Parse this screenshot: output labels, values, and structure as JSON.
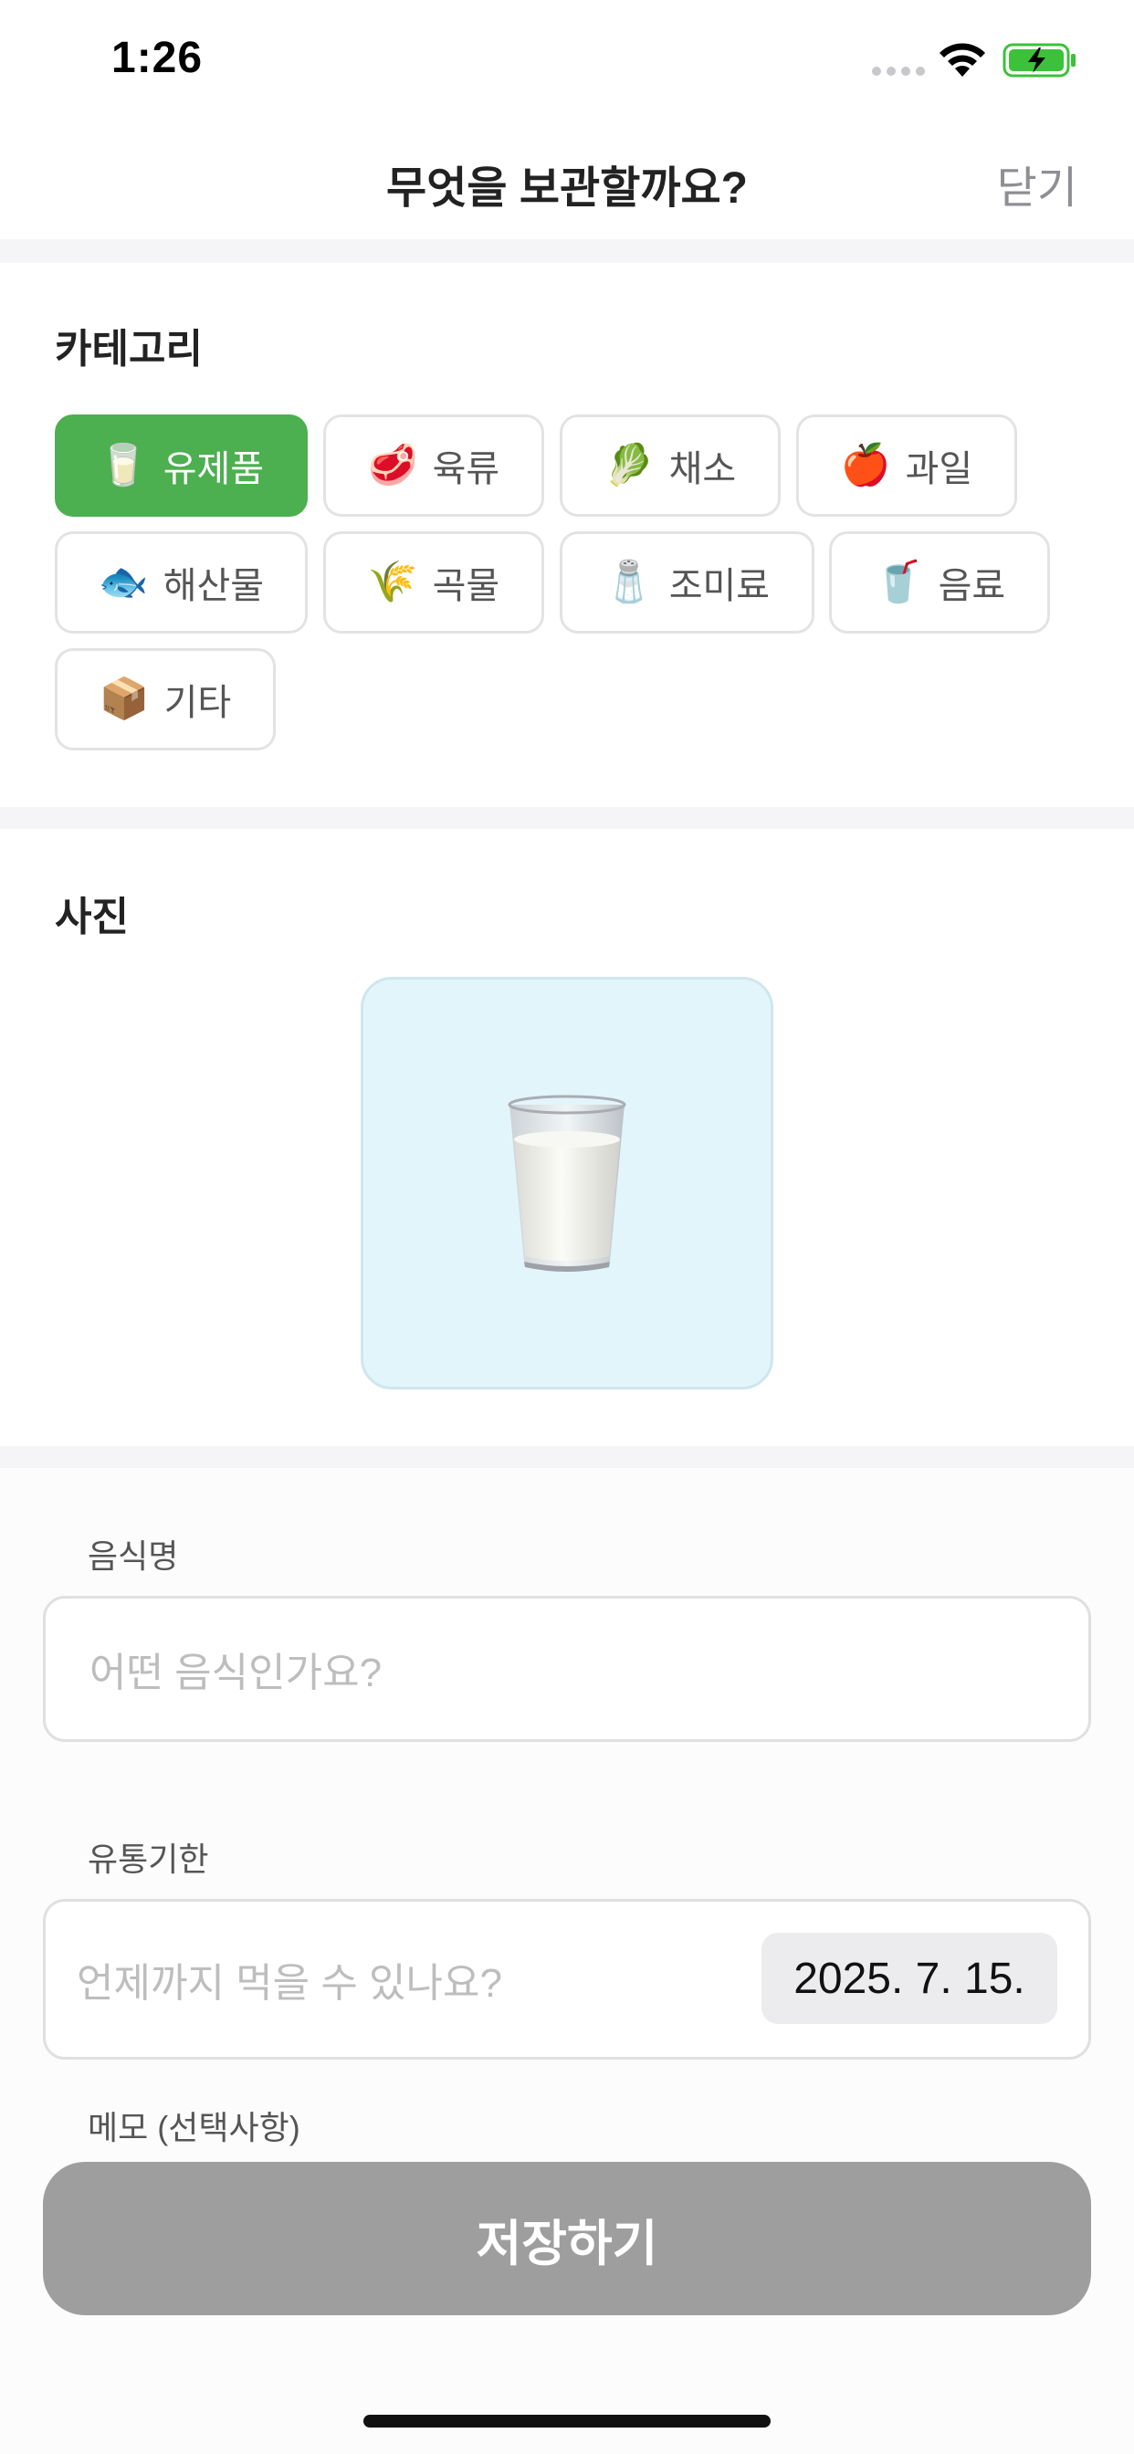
{
  "status_bar": {
    "time": "1:26"
  },
  "nav": {
    "title": "무엇을 보관할까요?",
    "close_label": "닫기"
  },
  "category": {
    "title": "카테고리",
    "selected": "유제품",
    "items": [
      {
        "icon": "milk-glass-icon",
        "emoji": "🥛",
        "label": "유제품"
      },
      {
        "icon": "meat-icon",
        "emoji": "🥩",
        "label": "육류"
      },
      {
        "icon": "leafy-green-icon",
        "emoji": "🥬",
        "label": "채소"
      },
      {
        "icon": "apple-icon",
        "emoji": "🍎",
        "label": "과일"
      },
      {
        "icon": "fish-icon",
        "emoji": "🐟",
        "label": "해산물"
      },
      {
        "icon": "rice-icon",
        "emoji": "🌾",
        "label": "곡물"
      },
      {
        "icon": "salt-icon",
        "emoji": "🧂",
        "label": "조미료"
      },
      {
        "icon": "cup-with-straw-icon",
        "emoji": "🥤",
        "label": "음료"
      },
      {
        "icon": "package-icon",
        "emoji": "📦",
        "label": "기타"
      }
    ]
  },
  "photo": {
    "title": "사진",
    "icon": "milk-glass-icon",
    "emoji": "🥛"
  },
  "form": {
    "food_name": {
      "label": "음식명",
      "placeholder": "어떤 음식인가요?",
      "value": ""
    },
    "expiry": {
      "label": "유통기한",
      "placeholder": "언제까지 먹을 수 있나요?",
      "date_value": "2025. 7. 15."
    },
    "memo": {
      "label": "메모 (선택사항)"
    }
  },
  "save_label": "저장하기",
  "colors": {
    "accent": "#4caf50",
    "photo_bg": "#e2f5fa",
    "save_disabled": "#9e9e9e"
  }
}
